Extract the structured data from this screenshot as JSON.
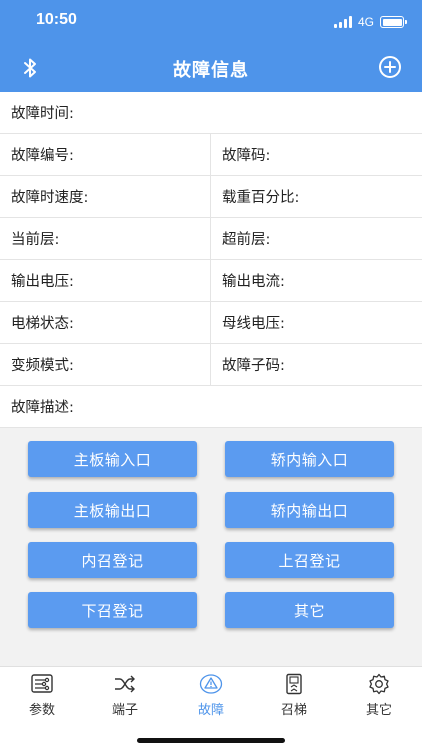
{
  "status_bar": {
    "time": "10:50",
    "network": "4G"
  },
  "header": {
    "title": "故障信息"
  },
  "fields": {
    "fault_time": "故障时间:",
    "fault_number": "故障编号:",
    "fault_code": "故障码:",
    "fault_speed": "故障时速度:",
    "load_percent": "载重百分比:",
    "current_floor": "当前层:",
    "advance_floor": "超前层:",
    "output_voltage": "输出电压:",
    "output_current": "输出电流:",
    "elevator_status": "电梯状态:",
    "bus_voltage": "母线电压:",
    "vfd_mode": "变频模式:",
    "fault_subcode": "故障子码:",
    "fault_description": "故障描述:"
  },
  "buttons": {
    "main_input": "主板输入口",
    "car_input": "轿内输入口",
    "main_output": "主板输出口",
    "car_output": "轿内输出口",
    "inner_call": "内召登记",
    "up_call": "上召登记",
    "down_call": "下召登记",
    "other": "其它"
  },
  "tabs": {
    "params": "参数",
    "terminal": "端子",
    "fault": "故障",
    "call": "召梯",
    "other": "其它",
    "active": "fault"
  },
  "colors": {
    "accent": "#4e94ea",
    "button": "#5b9bf0"
  }
}
